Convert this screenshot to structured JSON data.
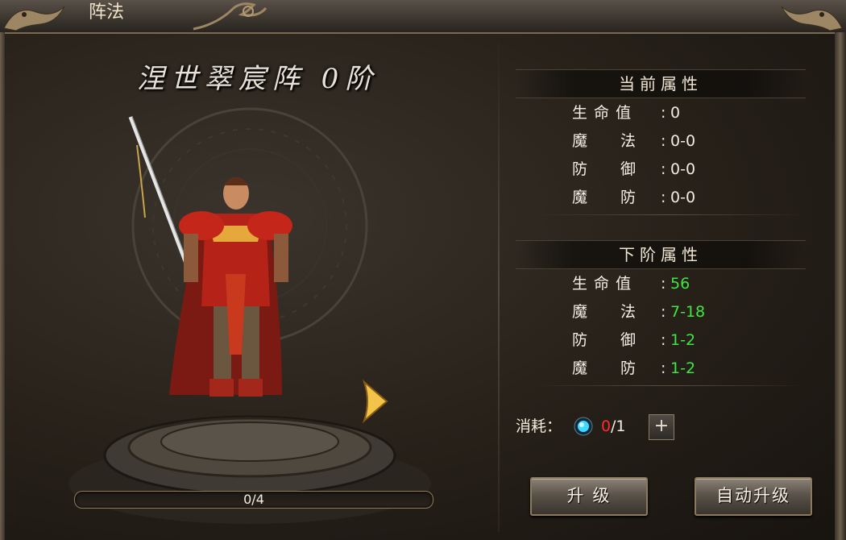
{
  "window": {
    "title": "阵法"
  },
  "formation": {
    "name": "涅世翠宸阵",
    "tier": "0阶",
    "title": "涅世翠宸阵 0阶"
  },
  "progress": {
    "text": "0/4",
    "current": 0,
    "total": 4
  },
  "current_attrs": {
    "heading": "当前属性",
    "rows": [
      {
        "label": "生 命 值",
        "value": "0"
      },
      {
        "label": "魔　　法",
        "value": "0-0"
      },
      {
        "label": "防　　御",
        "value": "0-0"
      },
      {
        "label": "魔　　防",
        "value": "0-0"
      }
    ]
  },
  "next_attrs": {
    "heading": "下阶属性",
    "rows": [
      {
        "label": "生 命 值",
        "value": "56"
      },
      {
        "label": "魔　　法",
        "value": "7-18"
      },
      {
        "label": "防　　御",
        "value": "1-2"
      },
      {
        "label": "魔　　防",
        "value": "1-2"
      }
    ]
  },
  "cost": {
    "label": "消耗：",
    "have": "0",
    "need": "/1",
    "icon": "blue-gem-icon",
    "plus": "+"
  },
  "buttons": {
    "upgrade": "升 级",
    "auto_upgrade": "自动升级"
  },
  "colors": {
    "next_value": "#3ee63e",
    "cost_have": "#ff2a2a"
  }
}
